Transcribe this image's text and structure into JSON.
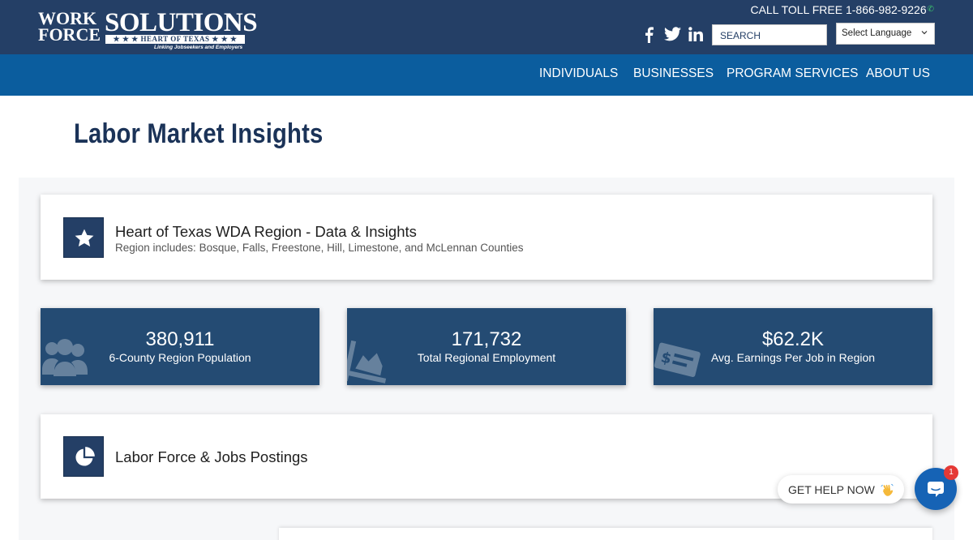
{
  "header": {
    "logo": {
      "line1": "WORK",
      "line2": "FORCE",
      "brand": "SOLUTIONS",
      "ribbon": "★ ★ ★ HEART OF TEXAS ★ ★ ★",
      "tagline": "Linking Jobseekers and Employers"
    },
    "toll_free": "CALL TOLL FREE 1-866-982-9226",
    "search_placeholder": "SEARCH",
    "language_select": "Select Language",
    "social_icons": [
      "facebook-icon",
      "twitter-icon",
      "linkedin-icon"
    ]
  },
  "nav": {
    "items": [
      {
        "label": "INDIVIDUALS"
      },
      {
        "label": "BUSINESSES"
      },
      {
        "label": "PROGRAM SERVICES"
      },
      {
        "label": "ABOUT US"
      }
    ]
  },
  "page": {
    "title": "Labor Market Insights"
  },
  "region_card": {
    "icon": "star-icon",
    "title": "Heart of Texas WDA Region - Data & Insights",
    "subtitle": "Region includes: Bosque, Falls, Freestone, Hill, Limestone, and McLennan Counties"
  },
  "stats": [
    {
      "value": "380,911",
      "label": "6-County Region Population",
      "icon": "users-icon"
    },
    {
      "value": "171,732",
      "label": "Total Regional Employment",
      "icon": "chart-area-icon"
    },
    {
      "value": "$62.2K",
      "label": "Avg. Earnings Per Job in Region",
      "icon": "money-check-icon"
    }
  ],
  "labor_card": {
    "icon": "pie-chart-icon",
    "title": "Labor Force & Jobs Postings"
  },
  "chat": {
    "help_label": "GET HELP NOW",
    "badge_count": "1"
  },
  "colors": {
    "header_bg": "#243f66",
    "nav_bg": "#0b5d9e",
    "stat_bg": "#244b73",
    "title_color": "#1b3358",
    "chat_blue": "#1663b5"
  }
}
